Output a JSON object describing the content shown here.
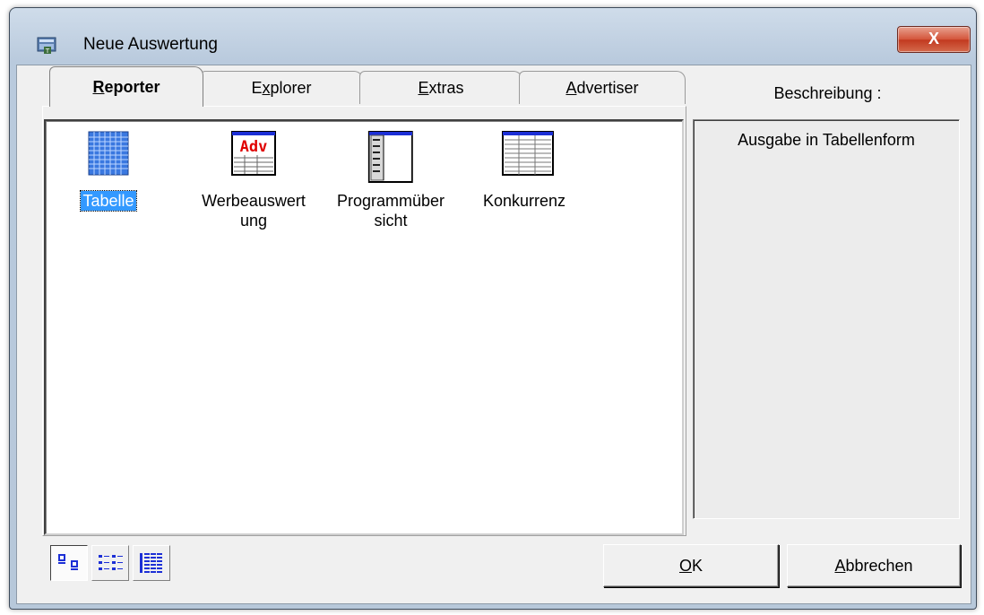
{
  "window": {
    "title": "Neue Auswertung",
    "close_label": "X"
  },
  "tabs": [
    {
      "prefix": "",
      "accel": "R",
      "rest": "eporter",
      "active": true
    },
    {
      "prefix": "E",
      "accel": "x",
      "rest": "plorer",
      "active": false
    },
    {
      "prefix": "",
      "accel": "E",
      "rest": "xtras",
      "active": false
    },
    {
      "prefix": "",
      "accel": "A",
      "rest": "dvertiser",
      "active": false
    }
  ],
  "items": [
    {
      "line1": "Tabelle",
      "line2": "",
      "icon": "table-grid-icon",
      "selected": true
    },
    {
      "line1": "Werbeauswert",
      "line2": "ung",
      "icon": "adv-report-icon",
      "selected": false
    },
    {
      "line1": "Programmüber",
      "line2": "sicht",
      "icon": "program-list-icon",
      "selected": false
    },
    {
      "line1": "Konkurrenz",
      "line2": "",
      "icon": "competition-table-icon",
      "selected": false
    }
  ],
  "description": {
    "title": "Beschreibung :",
    "text": "Ausgabe in Tabellenform"
  },
  "view_buttons": [
    "large-icons-view-icon",
    "list-view-icon",
    "details-view-icon"
  ],
  "buttons": {
    "ok": {
      "accel": "O",
      "rest": "K"
    },
    "cancel": {
      "accel": "A",
      "rest": "bbrechen"
    }
  },
  "colors": {
    "selection": "#3399ff",
    "close_button": "#c2391f",
    "adv_text": "#e00000"
  }
}
